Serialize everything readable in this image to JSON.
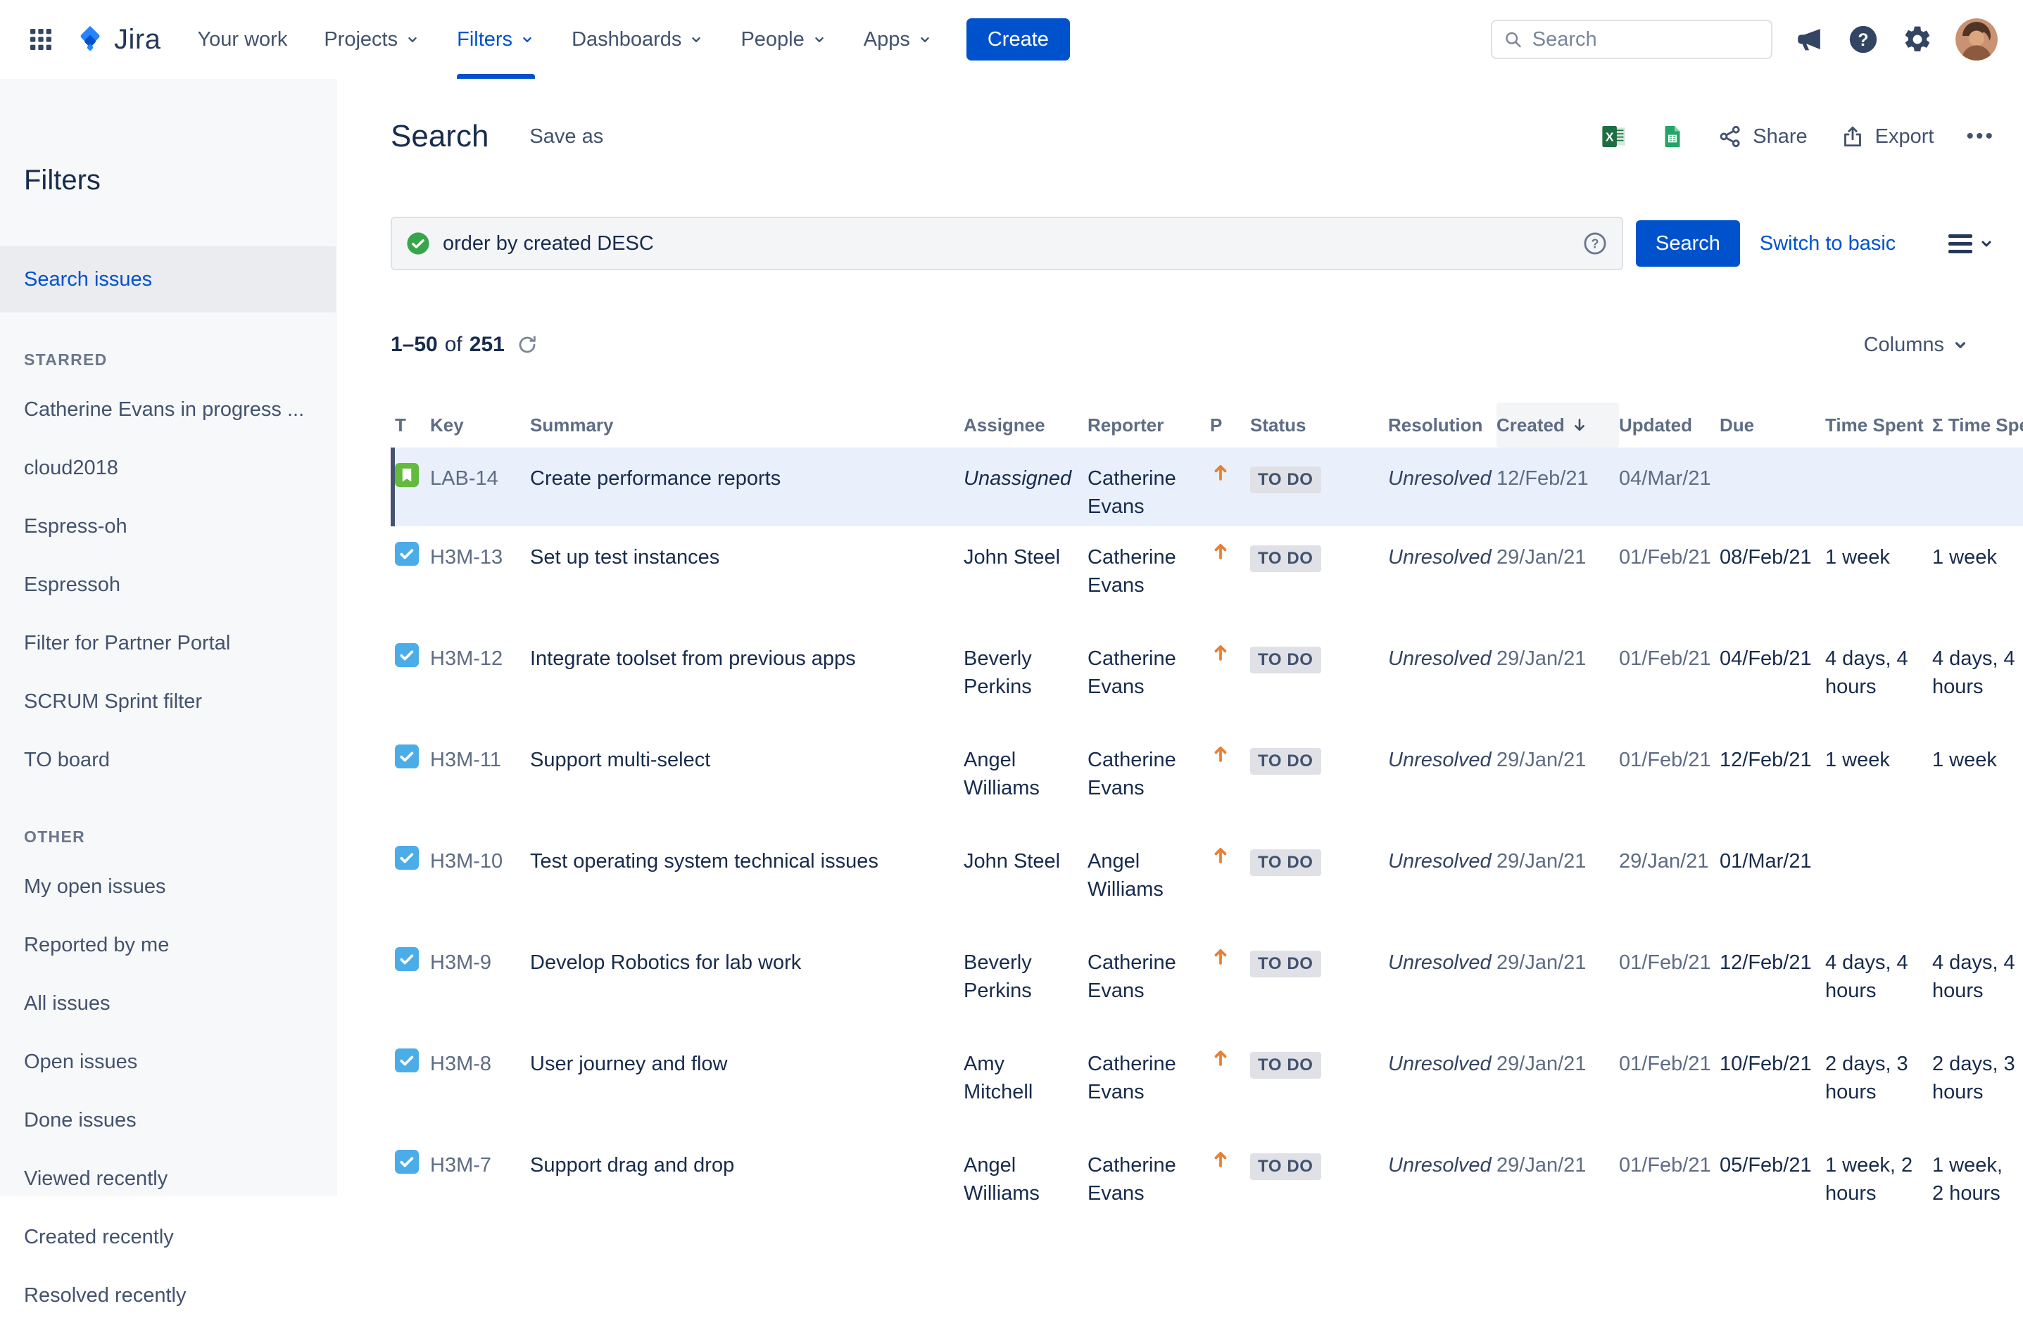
{
  "colors": {
    "primary": "#0052CC",
    "text": "#172B4D",
    "muted": "#5E6C84",
    "task_blue": "#4BADE8",
    "story_green": "#63BA3C",
    "priority_orange": "#E97F33",
    "success_green": "#37A64A"
  },
  "nav": {
    "logo_text": "Jira",
    "items": [
      {
        "label": "Your work",
        "chevron": false,
        "active": false
      },
      {
        "label": "Projects",
        "chevron": true,
        "active": false
      },
      {
        "label": "Filters",
        "chevron": true,
        "active": true
      },
      {
        "label": "Dashboards",
        "chevron": true,
        "active": false
      },
      {
        "label": "People",
        "chevron": true,
        "active": false
      },
      {
        "label": "Apps",
        "chevron": true,
        "active": false
      }
    ],
    "create_label": "Create",
    "search_placeholder": "Search"
  },
  "sidebar": {
    "title": "Filters",
    "search_item": "Search issues",
    "sections": [
      {
        "label": "STARRED",
        "items": [
          "Catherine Evans in progress ...",
          "cloud2018",
          "Espress-oh",
          "Espressoh",
          "Filter for Partner Portal",
          "SCRUM Sprint filter",
          "TO board"
        ]
      },
      {
        "label": "OTHER",
        "items": [
          "My open issues",
          "Reported by me",
          "All issues",
          "Open issues",
          "Done issues",
          "Viewed recently",
          "Created recently",
          "Resolved recently"
        ]
      }
    ]
  },
  "header": {
    "title": "Search",
    "save_as": "Save as",
    "share_label": "Share",
    "export_label": "Export",
    "more_label": "•••"
  },
  "query": {
    "text": "order by created DESC",
    "search_button": "Search",
    "switch_link": "Switch to basic"
  },
  "results": {
    "range": "1–50",
    "of_label": "of",
    "total": "251",
    "columns_label": "Columns"
  },
  "table": {
    "columns": [
      {
        "key": "type",
        "label": "T"
      },
      {
        "key": "key",
        "label": "Key"
      },
      {
        "key": "summary",
        "label": "Summary"
      },
      {
        "key": "assignee",
        "label": "Assignee"
      },
      {
        "key": "reporter",
        "label": "Reporter"
      },
      {
        "key": "priority",
        "label": "P"
      },
      {
        "key": "status",
        "label": "Status"
      },
      {
        "key": "resolution",
        "label": "Resolution"
      },
      {
        "key": "created",
        "label": "Created",
        "sorted": "desc"
      },
      {
        "key": "updated",
        "label": "Updated"
      },
      {
        "key": "due",
        "label": "Due"
      },
      {
        "key": "time_spent",
        "label": "Time Spent"
      },
      {
        "key": "sum_time_spent",
        "label": "Σ Time Spent"
      }
    ],
    "rows": [
      {
        "type": "story",
        "key": "LAB-14",
        "summary": "Create performance reports",
        "assignee": "Unassigned",
        "reporter": "Catherine Evans",
        "priority": "high",
        "status": "TO DO",
        "resolution": "Unresolved",
        "created": "12/Feb/21",
        "updated": "04/Mar/21",
        "due": "",
        "time_spent": "",
        "sum_time_spent": "",
        "selected": true
      },
      {
        "type": "task",
        "key": "H3M-13",
        "summary": "Set up test instances",
        "assignee": "John Steel",
        "reporter": "Catherine Evans",
        "priority": "high",
        "status": "TO DO",
        "resolution": "Unresolved",
        "created": "29/Jan/21",
        "updated": "01/Feb/21",
        "due": "08/Feb/21",
        "time_spent": "1 week",
        "sum_time_spent": "1 week",
        "selected": false
      },
      {
        "type": "task",
        "key": "H3M-12",
        "summary": "Integrate toolset from previous apps",
        "assignee": "Beverly Perkins",
        "reporter": "Catherine Evans",
        "priority": "high",
        "status": "TO DO",
        "resolution": "Unresolved",
        "created": "29/Jan/21",
        "updated": "01/Feb/21",
        "due": "04/Feb/21",
        "time_spent": "4 days, 4 hours",
        "sum_time_spent": "4 days, 4 hours",
        "selected": false
      },
      {
        "type": "task",
        "key": "H3M-11",
        "summary": "Support multi-select",
        "assignee": "Angel Williams",
        "reporter": "Catherine Evans",
        "priority": "high",
        "status": "TO DO",
        "resolution": "Unresolved",
        "created": "29/Jan/21",
        "updated": "01/Feb/21",
        "due": "12/Feb/21",
        "time_spent": "1 week",
        "sum_time_spent": "1 week",
        "selected": false
      },
      {
        "type": "task",
        "key": "H3M-10",
        "summary": "Test operating system technical issues",
        "assignee": "John Steel",
        "reporter": "Angel Williams",
        "priority": "high",
        "status": "TO DO",
        "resolution": "Unresolved",
        "created": "29/Jan/21",
        "updated": "29/Jan/21",
        "due": "01/Mar/21",
        "time_spent": "",
        "sum_time_spent": "",
        "selected": false
      },
      {
        "type": "task",
        "key": "H3M-9",
        "summary": "Develop Robotics for lab work",
        "assignee": "Beverly Perkins",
        "reporter": "Catherine Evans",
        "priority": "high",
        "status": "TO DO",
        "resolution": "Unresolved",
        "created": "29/Jan/21",
        "updated": "01/Feb/21",
        "due": "12/Feb/21",
        "time_spent": "4 days, 4 hours",
        "sum_time_spent": "4 days, 4 hours",
        "selected": false
      },
      {
        "type": "task",
        "key": "H3M-8",
        "summary": "User journey and flow",
        "assignee": "Amy Mitchell",
        "reporter": "Catherine Evans",
        "priority": "high",
        "status": "TO DO",
        "resolution": "Unresolved",
        "created": "29/Jan/21",
        "updated": "01/Feb/21",
        "due": "10/Feb/21",
        "time_spent": "2 days, 3 hours",
        "sum_time_spent": "2 days, 3 hours",
        "selected": false
      },
      {
        "type": "task",
        "key": "H3M-7",
        "summary": "Support drag and drop",
        "assignee": "Angel Williams",
        "reporter": "Catherine Evans",
        "priority": "high",
        "status": "TO DO",
        "resolution": "Unresolved",
        "created": "29/Jan/21",
        "updated": "01/Feb/21",
        "due": "05/Feb/21",
        "time_spent": "1 week, 2 hours",
        "sum_time_spent": "1 week, 2 hours",
        "selected": false
      }
    ]
  }
}
